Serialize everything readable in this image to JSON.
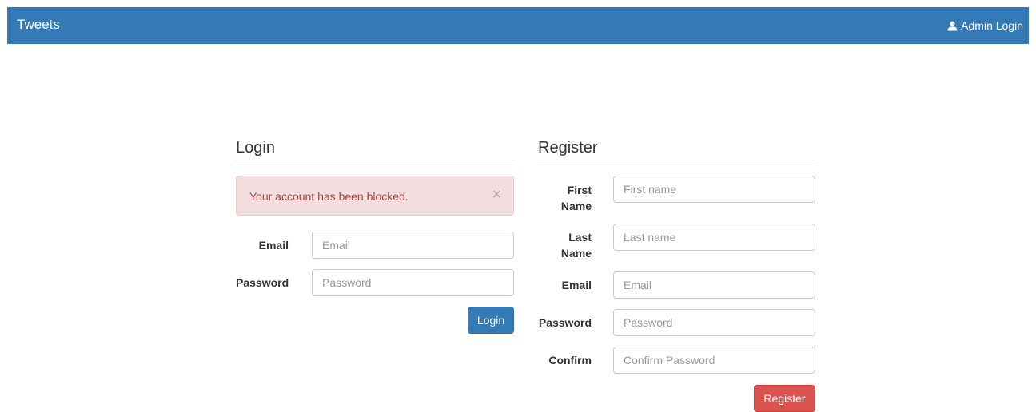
{
  "navbar": {
    "brand": "Tweets",
    "admin_login_label": "Admin Login",
    "admin_icon": "user-icon",
    "color": "#337ab7"
  },
  "login": {
    "title": "Login",
    "alert": {
      "message": "Your account has been blocked.",
      "close_symbol": "×"
    },
    "email": {
      "label": "Email",
      "placeholder": "Email",
      "value": ""
    },
    "password": {
      "label": "Password",
      "placeholder": "Password",
      "value": ""
    },
    "submit_label": "Login"
  },
  "register": {
    "title": "Register",
    "first_name": {
      "label_line1": "First",
      "label_line2": "Name",
      "placeholder": "First name",
      "value": ""
    },
    "last_name": {
      "label_line1": "Last",
      "label_line2": "Name",
      "placeholder": "Last name",
      "value": ""
    },
    "email": {
      "label": "Email",
      "placeholder": "Email",
      "value": ""
    },
    "password": {
      "label": "Password",
      "placeholder": "Password",
      "value": ""
    },
    "confirm": {
      "label": "Confirm",
      "placeholder": "Confirm Password",
      "value": ""
    },
    "submit_label": "Register"
  },
  "colors": {
    "primary": "#337ab7",
    "danger": "#d9534f",
    "alert_bg": "#f2dede",
    "alert_text": "#a94442"
  }
}
